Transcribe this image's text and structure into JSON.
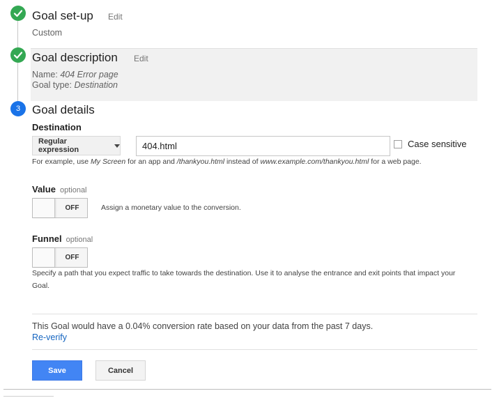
{
  "steps": [
    {
      "title": "Goal set-up",
      "edit": "Edit",
      "value": "Custom",
      "status": "complete"
    },
    {
      "title": "Goal description",
      "edit": "Edit",
      "status": "complete",
      "name_label": "Name:",
      "name_value": "404 Error page",
      "type_label": "Goal type:",
      "type_value": "Destination"
    },
    {
      "number": "3",
      "title": "Goal details",
      "status": "active"
    }
  ],
  "destination": {
    "label": "Destination",
    "match_type": "Regular expression",
    "value": "404.html",
    "case_sensitive_label": "Case sensitive",
    "case_sensitive": false,
    "help": {
      "prefix": "For example, use ",
      "ex1": "My Screen",
      "mid1": " for an app and ",
      "ex2": "/thankyou.html",
      "mid2": " instead of ",
      "ex3": "www.example.com/thankyou.html",
      "suffix": " for a web page."
    }
  },
  "value": {
    "label": "Value",
    "optional": "optional",
    "toggle": "OFF",
    "help": "Assign a monetary value to the conversion."
  },
  "funnel": {
    "label": "Funnel",
    "optional": "optional",
    "toggle": "OFF",
    "help_line1": "Specify a path that you expect traffic to take towards the destination. Use it to analyse the entrance and exit points that impact your",
    "help_line2": "Goal."
  },
  "verification": {
    "summary": "This Goal would have a 0.04% conversion rate based on your data from the past 7 days.",
    "link": "Re-verify"
  },
  "actions": {
    "save": "Save",
    "cancel": "Cancel"
  },
  "colors": {
    "complete": "#34a853",
    "active": "#1a73e8",
    "primary_button": "#4285f4",
    "link": "#1565c0"
  },
  "icons": {
    "complete": "check-icon",
    "dropdown": "caret-down-icon"
  }
}
